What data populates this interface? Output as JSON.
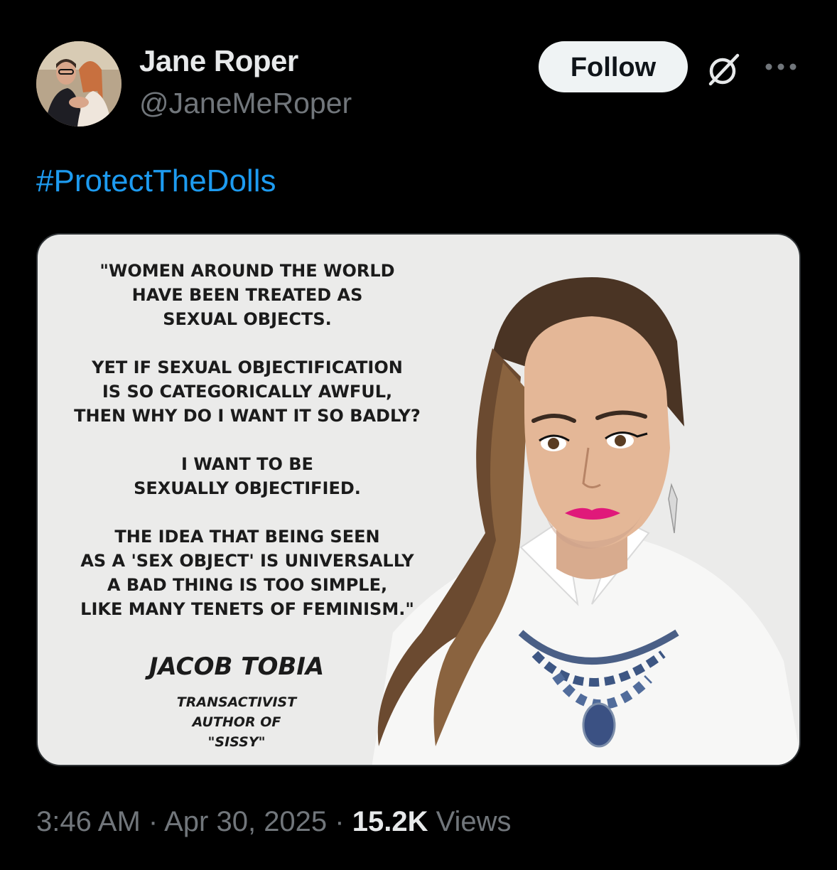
{
  "author": {
    "name": "Jane Roper",
    "handle": "@JaneMeRoper",
    "avatar_icon": "profile-photo"
  },
  "actions": {
    "follow_label": "Follow",
    "grok_icon": "grok-icon",
    "more_icon": "more-dots-icon"
  },
  "post": {
    "hashtag": "#ProtectTheDolls"
  },
  "media": {
    "quote_paragraphs": [
      "\"WOMEN AROUND THE WORLD\nHAVE BEEN TREATED AS\nSEXUAL OBJECTS.",
      "YET IF SEXUAL OBJECTIFICATION\nIS SO CATEGORICALLY AWFUL,\nTHEN WHY DO I WANT IT SO BADLY?",
      "I WANT TO BE\nSEXUALLY OBJECTIFIED.",
      "THE IDEA THAT BEING SEEN\nAS A 'SEX OBJECT' IS UNIVERSALLY\nA BAD THING IS TOO SIMPLE,\nLIKE MANY TENETS OF FEMINISM.\""
    ],
    "author_name": "JACOB TOBIA",
    "author_role": "TRANSACTIVIST\nAUTHOR OF\n\"SISSY\""
  },
  "meta": {
    "time": "3:46 AM",
    "separator": " · ",
    "date": "Apr 30, 2025",
    "views_count": "15.2K",
    "views_label": " Views"
  },
  "colors": {
    "background": "#000000",
    "hashtag": "#1d9bf0",
    "secondary_text": "#71767b",
    "follow_bg": "#eff3f4"
  }
}
